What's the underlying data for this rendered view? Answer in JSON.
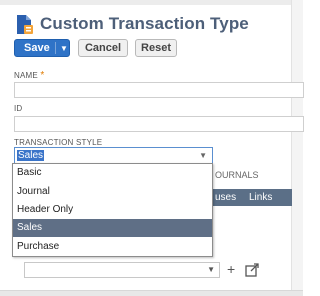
{
  "header": {
    "title": "Custom Transaction Type",
    "icon": "document-form-icon"
  },
  "toolbar": {
    "save_label": "Save",
    "cancel_label": "Cancel",
    "reset_label": "Reset"
  },
  "form": {
    "name_label": "NAME",
    "name_required_mark": "*",
    "id_label": "ID",
    "transaction_style_label": "TRANSACTION STYLE",
    "transaction_style_value": "Sales",
    "transaction_style_options": [
      "Basic",
      "Journal",
      "Header Only",
      "Sales",
      "Purchase"
    ],
    "selected_option": "Sales"
  },
  "background": {
    "journals_fragment": "OURNALS",
    "tab_fragment": "uses",
    "tab_links": "Links"
  },
  "colors": {
    "title": "#4d5f79",
    "primary_button": "#2f73c7",
    "selected_option": "#5f6f86",
    "required": "#e07b00"
  }
}
